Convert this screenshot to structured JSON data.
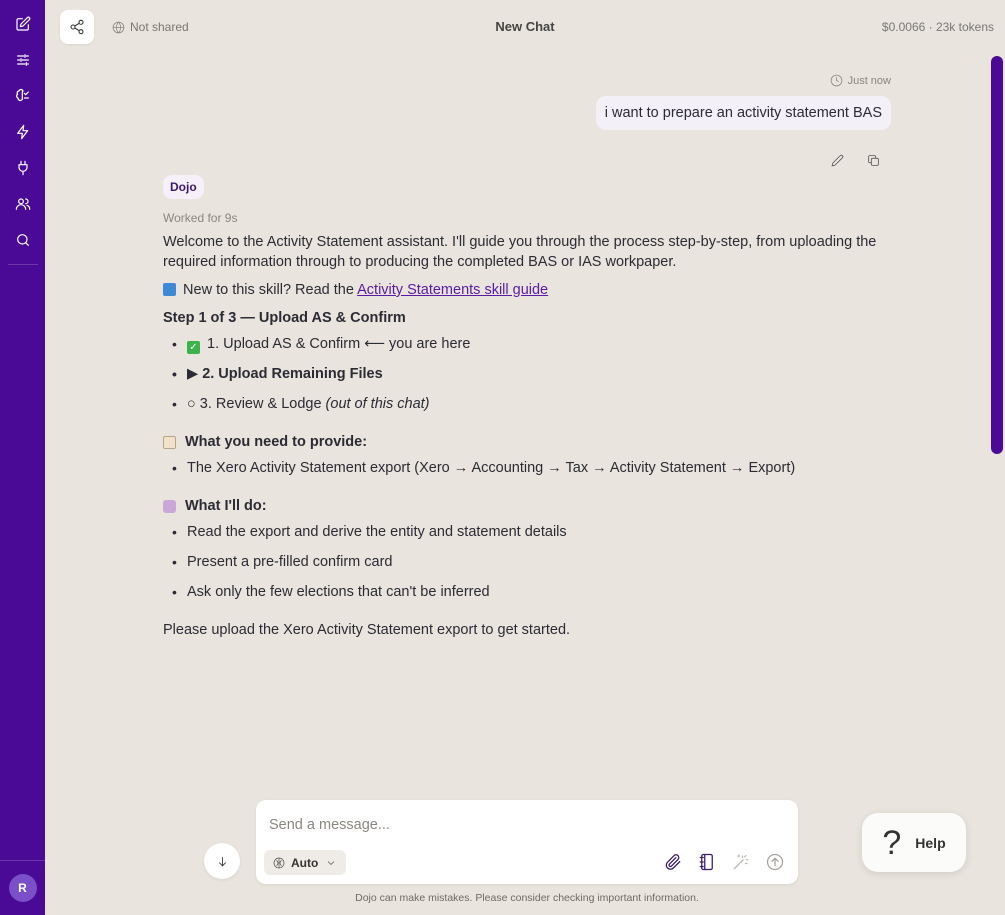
{
  "topbar": {
    "share_status": "Not shared",
    "title": "New Chat",
    "usage": "$0.0066 · 23k tokens"
  },
  "sidebar": {
    "items": [
      {
        "name": "new-chat",
        "icon": "pencil-square-icon"
      },
      {
        "name": "settings",
        "icon": "sliders-icon"
      },
      {
        "name": "skills",
        "icon": "brain-icon"
      },
      {
        "name": "automations",
        "icon": "lightning-icon"
      },
      {
        "name": "integrations",
        "icon": "plug-icon"
      },
      {
        "name": "team",
        "icon": "users-icon"
      },
      {
        "name": "search",
        "icon": "search-icon"
      }
    ],
    "avatar_initial": "R"
  },
  "user_message": {
    "timestamp": "Just now",
    "text": "i want to prepare an activity statement BAS"
  },
  "assistant": {
    "badge": "Dojo",
    "worked_for": "Worked for 9s",
    "intro": "Welcome to the Activity Statement assistant. I'll guide you through the process step-by-step, from uploading the required information through to producing the completed BAS or IAS workpaper.",
    "guide_prefix": "New to this skill? Read the ",
    "guide_link": "Activity Statements skill guide",
    "step_heading": "Step 1 of 3 — Upload AS & Confirm",
    "steps": [
      {
        "marker": "",
        "text": "1. Upload AS & Confirm ⟵ you are here"
      },
      {
        "marker": "▶",
        "text": "2. Upload Remaining Files"
      },
      {
        "marker": "○",
        "text": "3. Review & Lodge",
        "note": "(out of this chat)"
      }
    ],
    "provide_heading": "What you need to provide:",
    "provide_items": [
      "The Xero Activity Statement export (Xero → Accounting → Tax → Activity Statement → Export)"
    ],
    "do_heading": "What I'll do:",
    "do_items": [
      "Read the export and derive the entity and statement details",
      "Present a pre-filled confirm card",
      "Ask only the few elections that can't be inferred"
    ],
    "closing": "Please upload the Xero Activity Statement export to get started."
  },
  "composer": {
    "placeholder": "Send a message...",
    "model": "Auto",
    "disclaimer": "Dojo can make mistakes. Please consider checking important information."
  },
  "help": {
    "icon_glyph": "?",
    "label": "Help"
  },
  "colors": {
    "sidebar": "#4a0a96",
    "background": "#e9e4dd",
    "link": "#5a1aa6"
  }
}
